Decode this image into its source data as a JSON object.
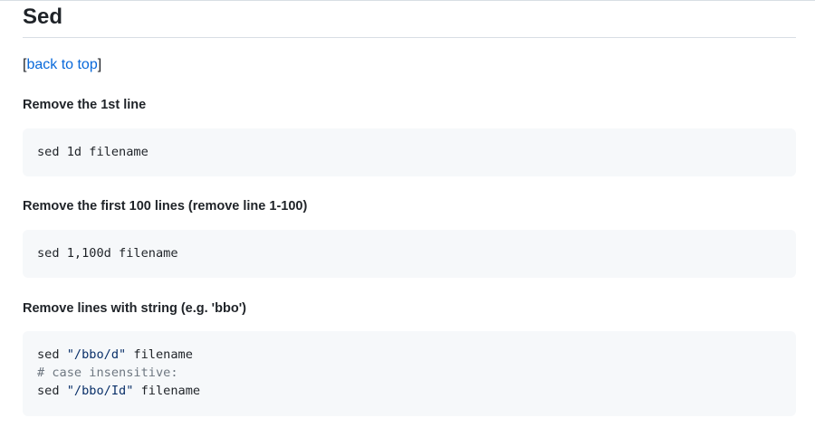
{
  "section": {
    "title": "Sed",
    "back_link": {
      "open_bracket": "[",
      "label": "back to top",
      "close_bracket": "]"
    }
  },
  "examples": [
    {
      "heading": "Remove the 1st line",
      "code_lines": [
        [
          {
            "t": "sed 1d filename",
            "k": "plain"
          }
        ]
      ]
    },
    {
      "heading": "Remove the first 100 lines (remove line 1-100)",
      "code_lines": [
        [
          {
            "t": "sed 1,100d filename",
            "k": "plain"
          }
        ]
      ]
    },
    {
      "heading": "Remove lines with string (e.g. 'bbo')",
      "code_lines": [
        [
          {
            "t": "sed ",
            "k": "plain"
          },
          {
            "t": "\"/bbo/d\"",
            "k": "string"
          },
          {
            "t": " filename",
            "k": "plain"
          }
        ],
        [
          {
            "t": "# case insensitive:",
            "k": "comment"
          }
        ],
        [
          {
            "t": "sed ",
            "k": "plain"
          },
          {
            "t": "\"/bbo/Id\"",
            "k": "string"
          },
          {
            "t": " filename",
            "k": "plain"
          }
        ]
      ]
    }
  ],
  "colors": {
    "link": "#0969da",
    "code_bg": "#f6f8fa",
    "string": "#0a3069",
    "comment": "#6e7781",
    "text": "#1f2328"
  }
}
